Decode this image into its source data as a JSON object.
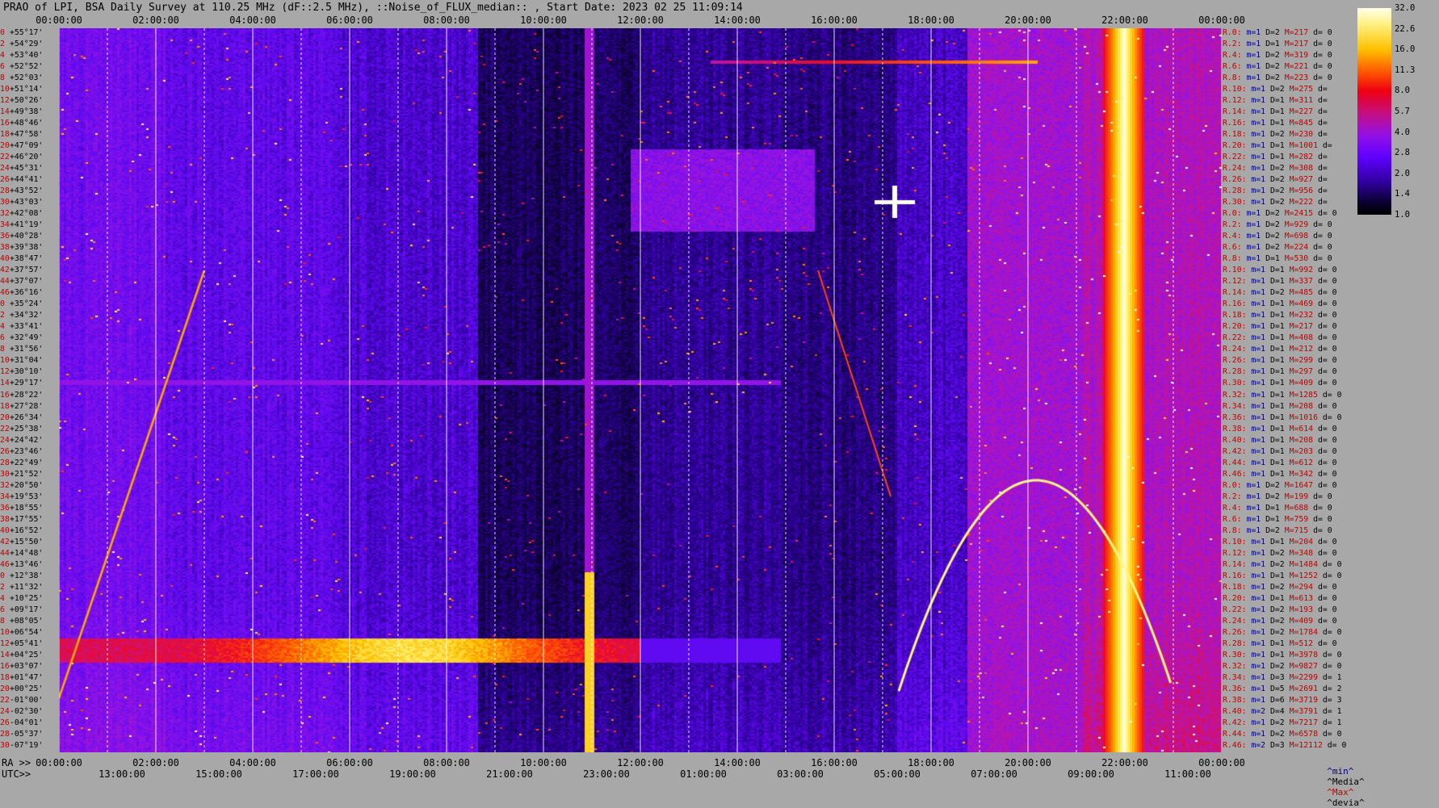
{
  "title": "PRAO of LPI, BSA Daily Survey at 110.25 MHz (dF::2.5 MHz), ::Noise_of_FLUX_median:: , Start Date: 2023 02 25 11:09:14",
  "chart_data": {
    "type": "heatmap",
    "top_axis_ticks": [
      "00:00:00",
      "02:00:00",
      "04:00:00",
      "06:00:00",
      "08:00:00",
      "10:00:00",
      "12:00:00",
      "14:00:00",
      "16:00:00",
      "18:00:00",
      "20:00:00",
      "22:00:00",
      "00:00:00"
    ],
    "ra_axis_label": "RA >>",
    "ra_axis_ticks": [
      "00:00:00",
      "02:00:00",
      "04:00:00",
      "06:00:00",
      "08:00:00",
      "10:00:00",
      "12:00:00",
      "14:00:00",
      "16:00:00",
      "18:00:00",
      "20:00:00",
      "22:00:00",
      "00:00:00"
    ],
    "utc_axis_label": "UTC>>",
    "utc_axis_ticks": [
      "13:00:00",
      "15:00:00",
      "17:00:00",
      "19:00:00",
      "21:00:00",
      "23:00:00",
      "01:00:00",
      "03:00:00",
      "05:00:00",
      "07:00:00",
      "09:00:00",
      "11:00:00"
    ],
    "colorbar_ticks": [
      "32.0",
      "22.6",
      "16.0",
      "11.3",
      "8.0",
      "5.7",
      "4.0",
      "2.8",
      "2.0",
      "1.4",
      "1.0"
    ],
    "colorbar_scale": "log",
    "colorbar_range": [
      1.0,
      32.0
    ],
    "declinations": [
      "+55°17'",
      "+54°29'",
      "+53°40'",
      "+52°52'",
      "+52°03'",
      "+51°14'",
      "+50°26'",
      "+49°38'",
      "+48°46'",
      "+47°58'",
      "+47°09'",
      "+46°20'",
      "+45°31'",
      "+44°41'",
      "+43°52'",
      "+43°03'",
      "+42°08'",
      "+41°19'",
      "+40°28'",
      "+39°38'",
      "+38°47'",
      "+37°57'",
      "+37°07'",
      "+36°16'",
      "+35°24'",
      "+34°32'",
      "+33°41'",
      "+32°49'",
      "+31°56'",
      "+31°04'",
      "+30°10'",
      "+29°17'",
      "+28°22'",
      "+27°28'",
      "+26°34'",
      "+25°38'",
      "+24°42'",
      "+23°46'",
      "+22°49'",
      "+21°52'",
      "+20°50'",
      "+19°53'",
      "+18°55'",
      "+17°55'",
      "+16°52'",
      "+15°50'",
      "+14°48'",
      "+13°46'",
      "+12°38'",
      "+11°32'",
      "+10°25'",
      "+09°17'",
      "+08°05'",
      "+06°54'",
      "+05°41'",
      "+04°25'",
      "+03°07'",
      "+01°47'",
      "+00°25'",
      "-01°00'",
      "-02°30'",
      "-04°01'",
      "-05°37'",
      "-07°19'"
    ],
    "row_indices": [
      "0",
      "2",
      "4",
      "6",
      "8",
      "10",
      "12",
      "14",
      "16",
      "18",
      "20",
      "22",
      "24",
      "26",
      "28",
      "30",
      "32",
      "34",
      "36",
      "38",
      "40",
      "42",
      "44",
      "46",
      "0",
      "2",
      "4",
      "6",
      "8",
      "10",
      "12",
      "14",
      "16",
      "18",
      "20",
      "22",
      "24",
      "26",
      "28",
      "30",
      "32",
      "34",
      "36",
      "38",
      "40",
      "42",
      "44",
      "46",
      "0",
      "2",
      "4",
      "6",
      "8",
      "10",
      "12",
      "14",
      "16",
      "18",
      "20",
      "22",
      "24",
      "26",
      "28",
      "30"
    ],
    "stats": [
      {
        "r": "R.0:",
        "m": "m=1",
        "d": "D=2",
        "M": "M=217",
        "dev": "d= 0"
      },
      {
        "r": "R.2:",
        "m": "m=1",
        "d": "D=1",
        "M": "M=217",
        "dev": "d= 0"
      },
      {
        "r": "R.4:",
        "m": "m=1",
        "d": "D=2",
        "M": "M=319",
        "dev": "d= 0"
      },
      {
        "r": "R.6:",
        "m": "m=1",
        "d": "D=2",
        "M": "M=221",
        "dev": "d= 0"
      },
      {
        "r": "R.8:",
        "m": "m=1",
        "d": "D=2",
        "M": "M=223",
        "dev": "d= 0"
      },
      {
        "r": "R.10:",
        "m": "m=1",
        "d": "D=2",
        "M": "M=275",
        "dev": "d="
      },
      {
        "r": "R.12:",
        "m": "m=1",
        "d": "D=1",
        "M": "M=311",
        "dev": "d="
      },
      {
        "r": "R.14:",
        "m": "m=1",
        "d": "D=1",
        "M": "M=227",
        "dev": "d="
      },
      {
        "r": "R.16:",
        "m": "m=1",
        "d": "D=1",
        "M": "M=845",
        "dev": "d="
      },
      {
        "r": "R.18:",
        "m": "m=1",
        "d": "D=2",
        "M": "M=230",
        "dev": "d="
      },
      {
        "r": "R.20:",
        "m": "m=1",
        "d": "D=1",
        "M": "M=1001",
        "dev": "d="
      },
      {
        "r": "R.22:",
        "m": "m=1",
        "d": "D=1",
        "M": "M=282",
        "dev": "d="
      },
      {
        "r": "R.24:",
        "m": "m=1",
        "d": "D=2",
        "M": "M=308",
        "dev": "d="
      },
      {
        "r": "R.26:",
        "m": "m=1",
        "d": "D=2",
        "M": "M=927",
        "dev": "d="
      },
      {
        "r": "R.28:",
        "m": "m=1",
        "d": "D=2",
        "M": "M=956",
        "dev": "d="
      },
      {
        "r": "R.30:",
        "m": "m=1",
        "d": "D=2",
        "M": "M=222",
        "dev": "d="
      },
      {
        "r": "R.0:",
        "m": "m=1",
        "d": "D=2",
        "M": "M=2415",
        "dev": "d= 0"
      },
      {
        "r": "R.2:",
        "m": "m=1",
        "d": "D=2",
        "M": "M=929",
        "dev": "d= 0"
      },
      {
        "r": "R.4:",
        "m": "m=1",
        "d": "D=2",
        "M": "M=698",
        "dev": "d= 0"
      },
      {
        "r": "R.6:",
        "m": "m=1",
        "d": "D=2",
        "M": "M=224",
        "dev": "d= 0"
      },
      {
        "r": "R.8:",
        "m": "m=1",
        "d": "D=1",
        "M": "M=530",
        "dev": "d= 0"
      },
      {
        "r": "R.10:",
        "m": "m=1",
        "d": "D=1",
        "M": "M=992",
        "dev": "d= 0"
      },
      {
        "r": "R.12:",
        "m": "m=1",
        "d": "D=1",
        "M": "M=337",
        "dev": "d= 0"
      },
      {
        "r": "R.14:",
        "m": "m=1",
        "d": "D=2",
        "M": "M=485",
        "dev": "d= 0"
      },
      {
        "r": "R.16:",
        "m": "m=1",
        "d": "D=1",
        "M": "M=469",
        "dev": "d= 0"
      },
      {
        "r": "R.18:",
        "m": "m=1",
        "d": "D=1",
        "M": "M=232",
        "dev": "d= 0"
      },
      {
        "r": "R.20:",
        "m": "m=1",
        "d": "D=1",
        "M": "M=217",
        "dev": "d= 0"
      },
      {
        "r": "R.22:",
        "m": "m=1",
        "d": "D=1",
        "M": "M=408",
        "dev": "d= 0"
      },
      {
        "r": "R.24:",
        "m": "m=1",
        "d": "D=1",
        "M": "M=212",
        "dev": "d= 0"
      },
      {
        "r": "R.26:",
        "m": "m=1",
        "d": "D=1",
        "M": "M=299",
        "dev": "d= 0"
      },
      {
        "r": "R.28:",
        "m": "m=1",
        "d": "D=1",
        "M": "M=297",
        "dev": "d= 0"
      },
      {
        "r": "R.30:",
        "m": "m=1",
        "d": "D=1",
        "M": "M=409",
        "dev": "d= 0"
      },
      {
        "r": "R.32:",
        "m": "m=1",
        "d": "D=1",
        "M": "M=1285",
        "dev": "d= 0"
      },
      {
        "r": "R.34:",
        "m": "m=1",
        "d": "D=1",
        "M": "M=208",
        "dev": "d= 0"
      },
      {
        "r": "R.36:",
        "m": "m=1",
        "d": "D=1",
        "M": "M=1016",
        "dev": "d= 0"
      },
      {
        "r": "R.38:",
        "m": "m=1",
        "d": "D=1",
        "M": "M=614",
        "dev": "d= 0"
      },
      {
        "r": "R.40:",
        "m": "m=1",
        "d": "D=1",
        "M": "M=208",
        "dev": "d= 0"
      },
      {
        "r": "R.42:",
        "m": "m=1",
        "d": "D=1",
        "M": "M=203",
        "dev": "d= 0"
      },
      {
        "r": "R.44:",
        "m": "m=1",
        "d": "D=1",
        "M": "M=612",
        "dev": "d= 0"
      },
      {
        "r": "R.46:",
        "m": "m=1",
        "d": "D=1",
        "M": "M=342",
        "dev": "d= 0"
      },
      {
        "r": "R.0:",
        "m": "m=1",
        "d": "D=2",
        "M": "M=1647",
        "dev": "d= 0"
      },
      {
        "r": "R.2:",
        "m": "m=1",
        "d": "D=2",
        "M": "M=199",
        "dev": "d= 0"
      },
      {
        "r": "R.4:",
        "m": "m=1",
        "d": "D=1",
        "M": "M=688",
        "dev": "d= 0"
      },
      {
        "r": "R.6:",
        "m": "m=1",
        "d": "D=1",
        "M": "M=759",
        "dev": "d= 0"
      },
      {
        "r": "R.8:",
        "m": "m=1",
        "d": "D=2",
        "M": "M=715",
        "dev": "d= 0"
      },
      {
        "r": "R.10:",
        "m": "m=1",
        "d": "D=1",
        "M": "M=204",
        "dev": "d= 0"
      },
      {
        "r": "R.12:",
        "m": "m=1",
        "d": "D=2",
        "M": "M=348",
        "dev": "d= 0"
      },
      {
        "r": "R.14:",
        "m": "m=1",
        "d": "D=2",
        "M": "M=1484",
        "dev": "d= 0"
      },
      {
        "r": "R.16:",
        "m": "m=1",
        "d": "D=1",
        "M": "M=1252",
        "dev": "d= 0"
      },
      {
        "r": "R.18:",
        "m": "m=1",
        "d": "D=2",
        "M": "M=294",
        "dev": "d= 0"
      },
      {
        "r": "R.20:",
        "m": "m=1",
        "d": "D=1",
        "M": "M=613",
        "dev": "d= 0"
      },
      {
        "r": "R.22:",
        "m": "m=1",
        "d": "D=2",
        "M": "M=193",
        "dev": "d= 0"
      },
      {
        "r": "R.24:",
        "m": "m=1",
        "d": "D=2",
        "M": "M=409",
        "dev": "d= 0"
      },
      {
        "r": "R.26:",
        "m": "m=1",
        "d": "D=2",
        "M": "M=1784",
        "dev": "d= 0"
      },
      {
        "r": "R.28:",
        "m": "m=1",
        "d": "D=1",
        "M": "M=512",
        "dev": "d= 0"
      },
      {
        "r": "R.30:",
        "m": "m=1",
        "d": "D=1",
        "M": "M=3978",
        "dev": "d= 0"
      },
      {
        "r": "R.32:",
        "m": "m=1",
        "d": "D=2",
        "M": "M=9827",
        "dev": "d= 0"
      },
      {
        "r": "R.34:",
        "m": "m=1",
        "d": "D=3",
        "M": "M=2299",
        "dev": "d= 1"
      },
      {
        "r": "R.36:",
        "m": "m=1",
        "d": "D=5",
        "M": "M=2691",
        "dev": "d= 2"
      },
      {
        "r": "R.38:",
        "m": "m=1",
        "d": "D=6",
        "M": "M=3719",
        "dev": "d= 3"
      },
      {
        "r": "R.40:",
        "m": "m=2",
        "d": "D=4",
        "M": "M=3791",
        "dev": "d= 1"
      },
      {
        "r": "R.42:",
        "m": "m=1",
        "d": "D=2",
        "M": "M=7217",
        "dev": "d= 1"
      },
      {
        "r": "R.44:",
        "m": "m=1",
        "d": "D=2",
        "M": "M=6578",
        "dev": "d= 0"
      },
      {
        "r": "R.46:",
        "m": "m=2",
        "d": "D=3",
        "M": "M=12112",
        "dev": "d= 0"
      }
    ],
    "stats_legend": {
      "min": "^min^",
      "median": "^Media^",
      "max": "^Max^",
      "dev": "^devia^"
    },
    "colors": {
      "low": "#000000",
      "mid": "#9010e8",
      "high": "#ee0010",
      "peak": "#ffffe8"
    }
  }
}
